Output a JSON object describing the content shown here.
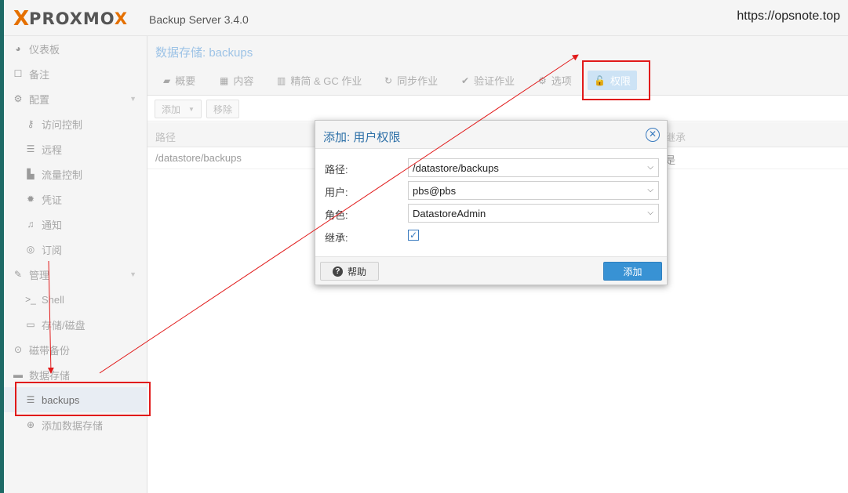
{
  "header": {
    "logo_x": "X",
    "logo_pro": "PRO",
    "logo_xmo": "XMO",
    "logo_x2": "X",
    "version": "Backup Server 3.4.0",
    "watermark": "https://opsnote.top"
  },
  "sidebar": {
    "items": [
      {
        "label": "仪表板",
        "icon": "dashboard-icon"
      },
      {
        "label": "备注",
        "icon": "notes-icon"
      },
      {
        "label": "配置",
        "icon": "gears-icon"
      },
      {
        "label": "访问控制",
        "icon": "key-icon"
      },
      {
        "label": "远程",
        "icon": "server-icon"
      },
      {
        "label": "流量控制",
        "icon": "bar-chart-icon"
      },
      {
        "label": "凭证",
        "icon": "certificate-icon"
      },
      {
        "label": "通知",
        "icon": "bell-icon"
      },
      {
        "label": "订阅",
        "icon": "support-icon"
      },
      {
        "label": "管理",
        "icon": "wrench-icon"
      },
      {
        "label": "Shell",
        "icon": "terminal-icon"
      },
      {
        "label": "存储/磁盘",
        "icon": "hdd-icon"
      },
      {
        "label": "磁带备份",
        "icon": "tape-icon"
      },
      {
        "label": "数据存储",
        "icon": "archive-icon"
      },
      {
        "label": "backups",
        "icon": "database-icon"
      },
      {
        "label": "添加数据存储",
        "icon": "plus-circle-icon"
      }
    ]
  },
  "main": {
    "title": "数据存储: backups",
    "tabs": [
      {
        "label": "概要",
        "icon": "book-icon"
      },
      {
        "label": "内容",
        "icon": "th-icon"
      },
      {
        "label": "精简 & GC 作业",
        "icon": "trash-icon"
      },
      {
        "label": "同步作业",
        "icon": "refresh-icon"
      },
      {
        "label": "验证作业",
        "icon": "check-circle-icon"
      },
      {
        "label": "选项",
        "icon": "gear-icon"
      },
      {
        "label": "权限",
        "icon": "unlock-icon"
      }
    ],
    "toolbar": {
      "add_label": "添加",
      "remove_label": "移除"
    },
    "columns": {
      "path": "路径",
      "propagate": "继承"
    },
    "rows": [
      {
        "path": "/datastore/backups",
        "propagate": "是"
      }
    ]
  },
  "dialog": {
    "title": "添加: 用户权限",
    "fields": {
      "path_label": "路径:",
      "path_value": "/datastore/backups",
      "user_label": "用户:",
      "user_value": "pbs@pbs",
      "role_label": "角色:",
      "role_value": "DatastoreAdmin",
      "propagate_label": "继承:",
      "propagate_checked": true
    },
    "help_label": "帮助",
    "submit_label": "添加"
  },
  "colors": {
    "accent": "#3892d4",
    "annotation": "#e11a1a",
    "logo_orange": "#e57000"
  }
}
